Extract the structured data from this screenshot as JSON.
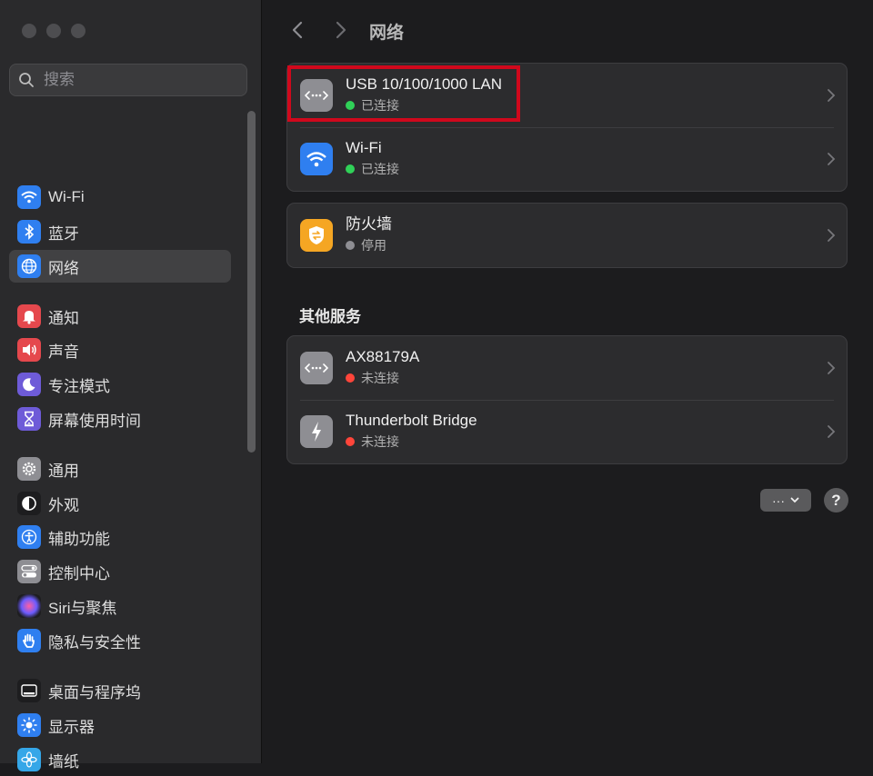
{
  "search": {
    "placeholder": "搜索"
  },
  "sidebar": {
    "items": [
      {
        "label": "Wi-Fi",
        "icon": "wifi-icon",
        "color": "#2f7ff0"
      },
      {
        "label": "蓝牙",
        "icon": "bluetooth-icon",
        "color": "#2f7ff0"
      },
      {
        "label": "网络",
        "icon": "globe-icon",
        "color": "#2f7ff0",
        "selected": true
      },
      {
        "label": "通知",
        "icon": "bell-icon",
        "color": "#e5484d"
      },
      {
        "label": "声音",
        "icon": "speaker-icon",
        "color": "#e5484d"
      },
      {
        "label": "专注模式",
        "icon": "moon-icon",
        "color": "#6e5bd8"
      },
      {
        "label": "屏幕使用时间",
        "icon": "hourglass-icon",
        "color": "#6e5bd8"
      },
      {
        "label": "通用",
        "icon": "gear-icon",
        "color": "#8e8e93"
      },
      {
        "label": "外观",
        "icon": "appearance-icon",
        "color": "#1d1d1f"
      },
      {
        "label": "辅助功能",
        "icon": "accessibility-icon",
        "color": "#2f7ff0"
      },
      {
        "label": "控制中心",
        "icon": "toggles-icon",
        "color": "#8e8e93"
      },
      {
        "label": "Siri与聚焦",
        "icon": "siri-icon",
        "color": "#9b5de5"
      },
      {
        "label": "隐私与安全性",
        "icon": "hand-icon",
        "color": "#2f7ff0"
      },
      {
        "label": "桌面与程序坞",
        "icon": "dock-icon",
        "color": "#1d1d1f"
      },
      {
        "label": "显示器",
        "icon": "sun-icon",
        "color": "#2f7ff0"
      },
      {
        "label": "墙纸",
        "icon": "flower-icon",
        "color": "#35a7e8"
      }
    ]
  },
  "toolbar": {
    "title": "网络"
  },
  "services": [
    {
      "name": "USB 10/100/1000 LAN",
      "status": "已连接",
      "status_color": "#30d158",
      "icon": "ethernet-icon",
      "icon_color": "#8e8e93"
    },
    {
      "name": "Wi-Fi",
      "status": "已连接",
      "status_color": "#30d158",
      "icon": "wifi-icon",
      "icon_color": "#2f7ff0"
    }
  ],
  "firewall": {
    "name": "防火墙",
    "status": "停用",
    "status_color": "#8e8e93",
    "icon": "firewall-icon",
    "icon_color": "#f5a623"
  },
  "other_services": {
    "title": "其他服务",
    "items": [
      {
        "name": "AX88179A",
        "status": "未连接",
        "status_color": "#ff453a",
        "icon": "ethernet-icon",
        "icon_color": "#8e8e93"
      },
      {
        "name": "Thunderbolt Bridge",
        "status": "未连接",
        "status_color": "#ff453a",
        "icon": "thunderbolt-icon",
        "icon_color": "#8e8e93"
      }
    ]
  },
  "actions": {
    "more_label": "···",
    "help_label": "?"
  }
}
